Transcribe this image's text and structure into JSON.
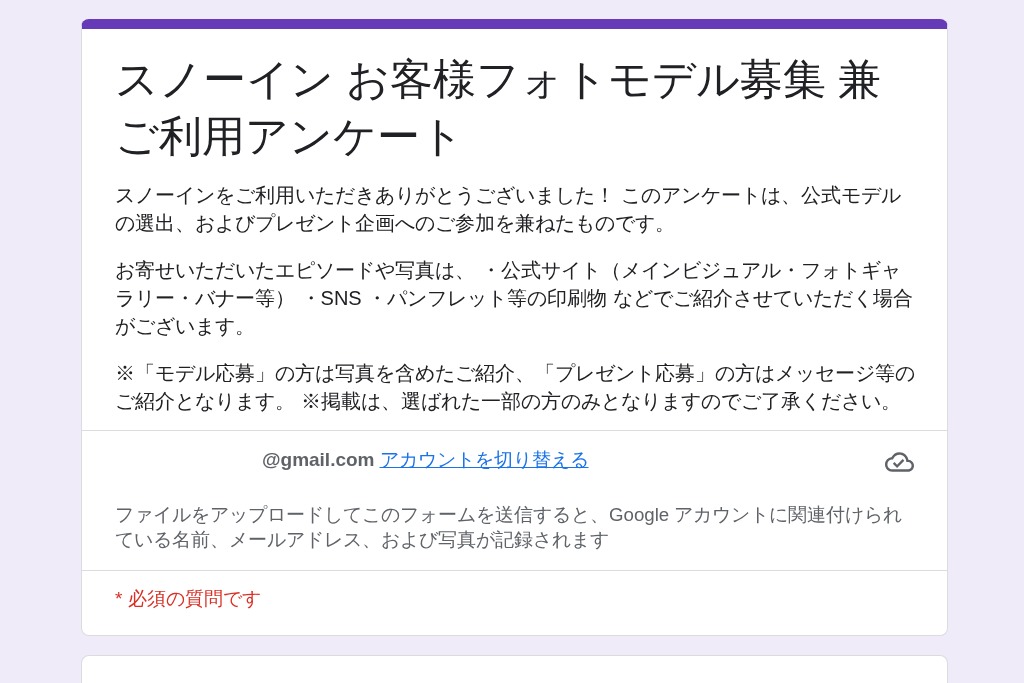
{
  "header": {
    "title": "スノーイン お客様フォトモデル募集 兼ご利用アンケート",
    "description": [
      "スノーインをご利用いただきありがとうございました！ このアンケートは、公式モデルの選出、およびプレゼント企画へのご参加を兼ねたものです。",
      "お寄せいただいたエピソードや写真は、 ・公式サイト（メインビジュアル・フォトギャラリー・バナー等） ・SNS ・パンフレット等の印刷物 などでご紹介させていただく場合がございます。",
      "※「モデル応募」の方は写真を含めたご紹介、「プレゼント応募」の方はメッセージ等のご紹介となります。 ※掲載は、選ばれた一部の方のみとなりますのでご了承ください。"
    ]
  },
  "account": {
    "email": "@gmail.com",
    "switch_link": "アカウントを切り替える",
    "notice": "ファイルをアップロードしてこのフォームを送信すると、Google アカウントに関連付けられている名前、メールアドレス、および写真が記録されます"
  },
  "required_note": "* 必須の質問です"
}
